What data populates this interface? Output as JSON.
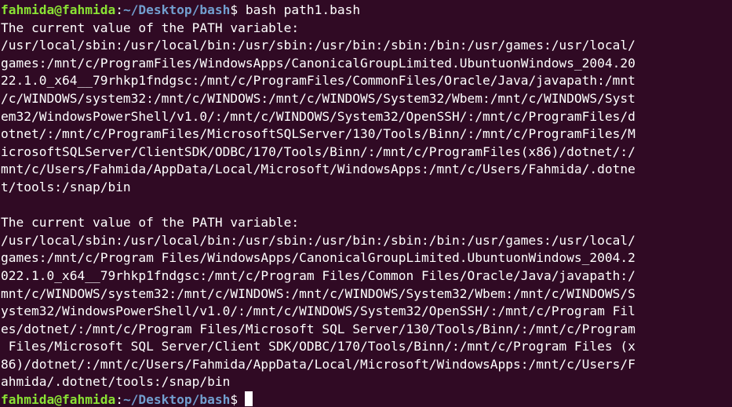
{
  "prompt": {
    "user_host": "fahmida@fahmida",
    "colon": ":",
    "cwd": "~/Desktop/bash",
    "symbol": "$"
  },
  "command": " bash path1.bash",
  "output": [
    "The current value of the PATH variable:",
    "/usr/local/sbin:/usr/local/bin:/usr/sbin:/usr/bin:/sbin:/bin:/usr/games:/usr/local/",
    "games:/mnt/c/ProgramFiles/WindowsApps/CanonicalGroupLimited.UbuntuonWindows_2004.20",
    "22.1.0_x64__79rhkp1fndgsc:/mnt/c/ProgramFiles/CommonFiles/Oracle/Java/javapath:/mnt",
    "/c/WINDOWS/system32:/mnt/c/WINDOWS:/mnt/c/WINDOWS/System32/Wbem:/mnt/c/WINDOWS/Syst",
    "em32/WindowsPowerShell/v1.0/:/mnt/c/WINDOWS/System32/OpenSSH/:/mnt/c/ProgramFiles/d",
    "otnet/:/mnt/c/ProgramFiles/MicrosoftSQLServer/130/Tools/Binn/:/mnt/c/ProgramFiles/M",
    "icrosoftSQLServer/ClientSDK/ODBC/170/Tools/Binn/:/mnt/c/ProgramFiles(x86)/dotnet/:/",
    "mnt/c/Users/Fahmida/AppData/Local/Microsoft/WindowsApps:/mnt/c/Users/Fahmida/.dotne",
    "t/tools:/snap/bin",
    "",
    "The current value of the PATH variable:",
    "/usr/local/sbin:/usr/local/bin:/usr/sbin:/usr/bin:/sbin:/bin:/usr/games:/usr/local/",
    "games:/mnt/c/Program Files/WindowsApps/CanonicalGroupLimited.UbuntuonWindows_2004.2",
    "022.1.0_x64__79rhkp1fndgsc:/mnt/c/Program Files/Common Files/Oracle/Java/javapath:/",
    "mnt/c/WINDOWS/system32:/mnt/c/WINDOWS:/mnt/c/WINDOWS/System32/Wbem:/mnt/c/WINDOWS/S",
    "ystem32/WindowsPowerShell/v1.0/:/mnt/c/WINDOWS/System32/OpenSSH/:/mnt/c/Program Fil",
    "es/dotnet/:/mnt/c/Program Files/Microsoft SQL Server/130/Tools/Binn/:/mnt/c/Program",
    " Files/Microsoft SQL Server/Client SDK/ODBC/170/Tools/Binn/:/mnt/c/Program Files (x",
    "86)/dotnet/:/mnt/c/Users/Fahmida/AppData/Local/Microsoft/WindowsApps:/mnt/c/Users/F",
    "ahmida/.dotnet/tools:/snap/bin"
  ],
  "colors": {
    "background": "#300a24",
    "user_host": "#8ae234",
    "cwd": "#729fcf",
    "text": "#ffffff"
  }
}
